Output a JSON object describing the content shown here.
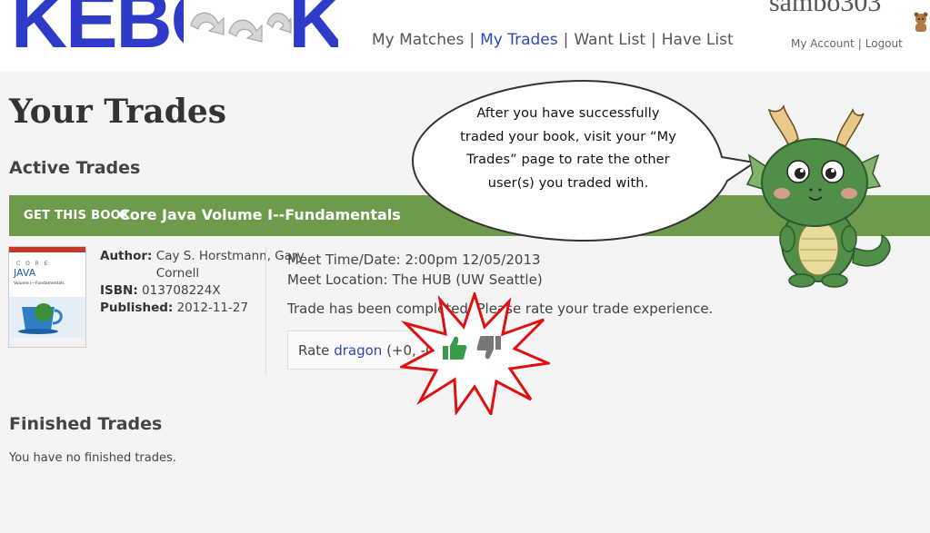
{
  "header": {
    "logo_text": "KEBOOK",
    "nav": [
      "My Matches",
      "My Trades",
      "Want List",
      "Have List"
    ],
    "nav_active": "My Trades",
    "username": "sambo303",
    "account_link": "My Account",
    "logout_link": "Logout"
  },
  "main": {
    "title": "Your Trades",
    "active_section": "Active Trades",
    "trade": {
      "banner_prefix": "GET THIS BOOK:",
      "book_title": "Core Java Volume I--Fundamentals",
      "cover_title": "JAVA",
      "cover_subtitle": "Volume I—Fundamentals",
      "author_label": "Author:",
      "author_value": "Cay S. Horstmann, Gary Cornell",
      "isbn_label": "ISBN:",
      "isbn_value": "013708224X",
      "published_label": "Published:",
      "published_value": "2012-11-27",
      "meet_time": "Meet Time/Date: 2:00pm 12/05/2013",
      "meet_location": "Meet Location: The HUB (UW Seattle)",
      "status": "Trade has been completed. Please rate your trade experience.",
      "rate_label": "Rate",
      "rate_user": "dragon",
      "rate_score": "(+0, -0)"
    },
    "finished_section": "Finished Trades",
    "no_finished": "You have no finished trades."
  },
  "annotation": {
    "bubble_text": "After you have successfully traded your book, visit your “My Trades” page to rate the other user(s) you traded with."
  },
  "colors": {
    "banner": "#6d9a4b",
    "link": "#2b49b3",
    "logo": "#2e3bc9",
    "thumb_up": "#3a9a4a",
    "thumb_down": "#777777",
    "burst_outline": "#e01010"
  }
}
